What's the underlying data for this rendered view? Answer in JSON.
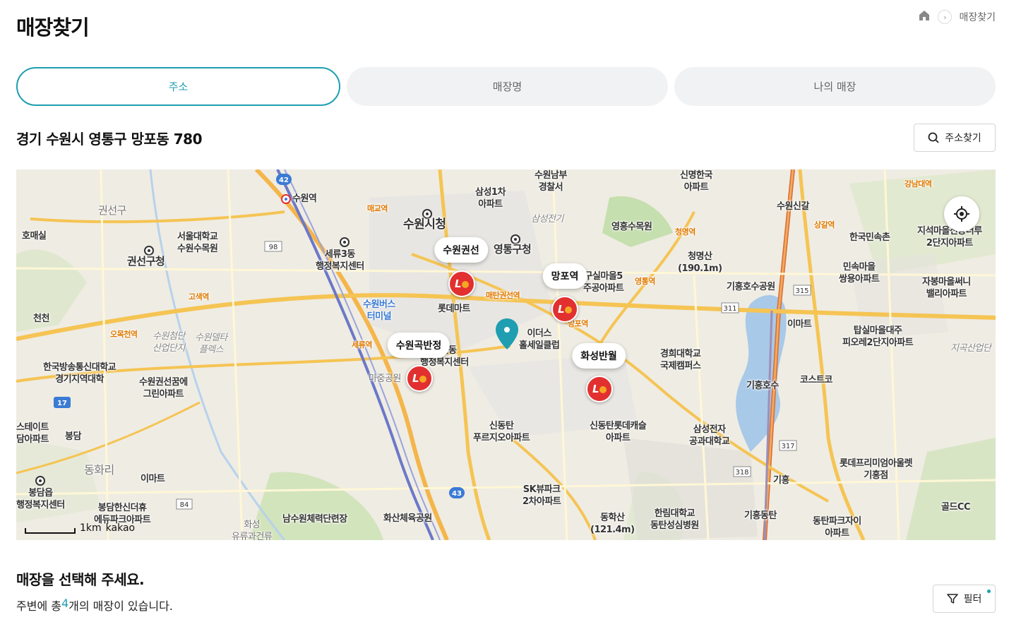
{
  "header": {
    "title": "매장찾기",
    "breadcrumb": {
      "current": "매장찾기"
    }
  },
  "tabs": [
    {
      "label": "주소",
      "active": true
    },
    {
      "label": "매장명",
      "active": false
    },
    {
      "label": "나의 매장",
      "active": false
    }
  ],
  "address": {
    "current": "경기 수원시 영통구 망포동 780",
    "search_button": "주소찾기"
  },
  "map": {
    "stores": [
      {
        "name": "수원권선"
      },
      {
        "name": "망포역"
      },
      {
        "name": "수원곡반정"
      },
      {
        "name": "화성반월"
      }
    ],
    "labels": {
      "suwon_city_hall": "수원시청",
      "yeongtong_gu": "영통구청",
      "gwonseon_gu": "권선구청",
      "gwonseon": "권선구",
      "suwon_station": "수원역",
      "maegyo": "매교역",
      "homaesil": "호매실",
      "cheoncheon": "천천",
      "seoul_univ": "서울대학교\n수원수목원",
      "seryu3": "세류3동\n행정복지센터",
      "bus_terminal": "수원버스\n터미널",
      "lotte_mart": "롯데마트",
      "samsung1": "삼성1차\n아파트",
      "suwon_police": "수원남부\n경찰서",
      "samsung_electronics": "삼성전기",
      "shinmyeong": "신명한국\n아파트",
      "suwon_singal": "수원신갈",
      "sanggal": "상갈역",
      "folk_village": "한국민속촌",
      "jiseok": "지석마을신동더루\n2단지아파트",
      "cheongmyeong": "청명역",
      "cheongmyeongsan": "청명산\n(190.1m)",
      "yeongheung": "영흥수목원",
      "gugul": "구실마을5\n주공아파트",
      "mangpo": "망포역",
      "giheung_park": "기흥호수공원",
      "minsok_maeul": "민속마을\n쌍용아파트",
      "jabong": "자봉마을써니\n밸리아파트",
      "emart1": "이마트",
      "tapsil": "탑실마을대주\n피오레2단지아파트",
      "jiseok_industrial": "지곡산업단",
      "khu": "경희대학교\n국제캠퍼스",
      "giheung_lake": "기흥호수",
      "costco": "코스트코",
      "traders": "이더스\n홀세일클럽",
      "gokbanjeong": "곡선동\n행정복지센터",
      "majung_park": "마중공원",
      "suwon_cheomdan": "수원첨단\n산업단지",
      "suwon_delta": "수원델타\n플렉스",
      "korea_univ": "한국방송통신대학교\n경기지역대학",
      "suwon_gwonseon_apt": "수원권선꿈에\n그린아파트",
      "gyeongsu": "스테이트\n담아파트",
      "bongdam": "봉담",
      "donghwa": "동화리",
      "emart2": "이마트",
      "bongdam_office": "봉담읍\n행정복지센터",
      "bongdam_hanshin": "봉담한신더휴\n에듀파크아파트",
      "hwaseong_sports": "화성\n유류과건류",
      "namsuwon": "남수원체력단련장",
      "hwasan": "화산체육공원",
      "sindongtan": "신동탄\n푸르지오아파트",
      "sk_view": "SK뷰파크\n2차아파트",
      "donghaksan": "동학산\n(121.4m)",
      "hallym": "한림대학교\n동탄성심병원",
      "sindongtan_lotte": "신동탄롯데캐슬\n아파트",
      "samsung_college": "삼성전자\n공과대학교",
      "lotte_outlet": "롯데프리미엄아울렛\n기흥점",
      "giheung": "기흥",
      "giheung_dongtan": "기흥동탄",
      "dongtan_park": "동탄파크자이\n아파트",
      "golf": "골드CC",
      "gosaek": "고색역",
      "omokcheon": "오목천역",
      "seryu": "세류역",
      "maetan": "매탄권선역",
      "yeongtong": "영통역",
      "gangnam_station": "강남대역"
    },
    "scale_label": "1km",
    "attribution": "kakao"
  },
  "results": {
    "title": "매장을 선택해 주세요.",
    "prefix": "주변에 총 ",
    "count": "4",
    "suffix": "개의 매장이 있습니다.",
    "filter_label": "필터"
  }
}
